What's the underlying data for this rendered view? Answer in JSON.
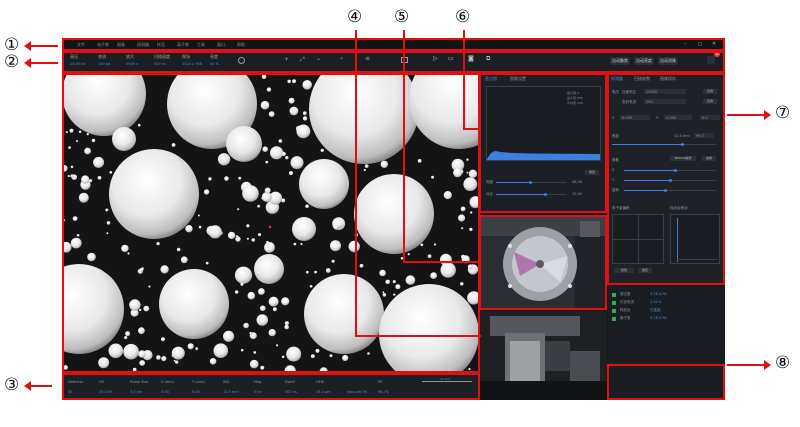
{
  "markers": {
    "m1": "①",
    "m2": "②",
    "m3": "③",
    "m4": "④",
    "m5": "⑤",
    "m6": "⑥",
    "m7": "⑦",
    "m8": "⑧"
  },
  "colors": {
    "annotation": "#e01010",
    "accent": "#3d7ee0",
    "app_bg": "#17191d"
  },
  "menu": [
    "文件",
    "电子束",
    "图像",
    "探测器",
    "样品",
    "离子束",
    "工具",
    "窗口",
    "帮助"
  ],
  "window_controls": {
    "min": "–",
    "max": "◻",
    "close": "✕"
  },
  "toolbar": {
    "groups": [
      {
        "label": "高压",
        "value": "20.00 kV"
      },
      {
        "label": "束流",
        "value": "100 pA"
      },
      {
        "label": "放大",
        "value": "5000 x"
      },
      {
        "label": "扫描速度",
        "value": "500 ns"
      },
      {
        "label": "视场",
        "value": "1024 x 768"
      },
      {
        "label": "亮度",
        "value": "50 %"
      }
    ],
    "right_buttons": [
      "自动聚焦",
      "自动亮度",
      "自动消像"
    ],
    "badge": "1"
  },
  "spectrum_panel": {
    "tabs": [
      "直方图",
      "图像设置"
    ],
    "legend": [
      "最小值 0",
      "最大值 255",
      "平均值 128"
    ],
    "reset_label": "重置",
    "sliders": [
      {
        "label": "亮度",
        "value": "48.28",
        "level": 0.48
      },
      {
        "label": "对比",
        "value": "70.00",
        "level": 0.7
      }
    ]
  },
  "right_panel": {
    "tabs": [
      "探测器",
      "扫描参数",
      "图像保存"
    ],
    "rows": [
      {
        "label": "电压",
        "field": "加速电压",
        "value": "20000"
      },
      {
        "label": "",
        "field": "发射电流",
        "value": "100"
      }
    ],
    "apply_label": "应用",
    "coords": {
      "x_label": "X",
      "x_value": "0.000",
      "y_label": "Y",
      "y_value": "0.000",
      "z_value": "0.0"
    },
    "focus": {
      "label": "焦距",
      "value": "12.5 mm",
      "value2": "99.7"
    },
    "mode_label": "Wobble模式",
    "mode_btn": "启用",
    "stig_label": "像散",
    "sliders": [
      {
        "label": "X",
        "level": 0.55
      },
      {
        "label": "Y",
        "level": 0.5
      },
      {
        "label": "旋转",
        "level": 0.45
      }
    ],
    "pad_left_title": "电子束偏移",
    "pad_right_title": "样品台移动",
    "pad_btns": [
      "复位",
      "锁定"
    ]
  },
  "status_bar": {
    "cols": [
      {
        "h": "Detector",
        "v": "SE"
      },
      {
        "h": "HV",
        "v": "20.0 kV"
      },
      {
        "h": "Probe Size",
        "v": "3.5 nm"
      },
      {
        "h": "X (mm)",
        "v": "0.00"
      },
      {
        "h": "Y (mm)",
        "v": "0.00"
      },
      {
        "h": "WD",
        "v": "12.5 mm"
      },
      {
        "h": "Mag",
        "v": "5 kx"
      },
      {
        "h": "Dwell",
        "v": "500 ns"
      },
      {
        "h": "HFW",
        "v": "25.4 μm"
      },
      {
        "h": "",
        "v": "Vacuum OK"
      },
      {
        "h": "PE",
        "v": "98.7%"
      }
    ],
    "scale_label": "10 μm"
  },
  "info_panel": [
    {
      "label": "真空度",
      "value": "3.2E-4 Pa"
    },
    {
      "label": "灯丝电流",
      "value": "2.42 A"
    },
    {
      "label": "样品台",
      "value": "已连接"
    },
    {
      "label": "离子泵",
      "value": "5.1E-5 Pa"
    }
  ]
}
